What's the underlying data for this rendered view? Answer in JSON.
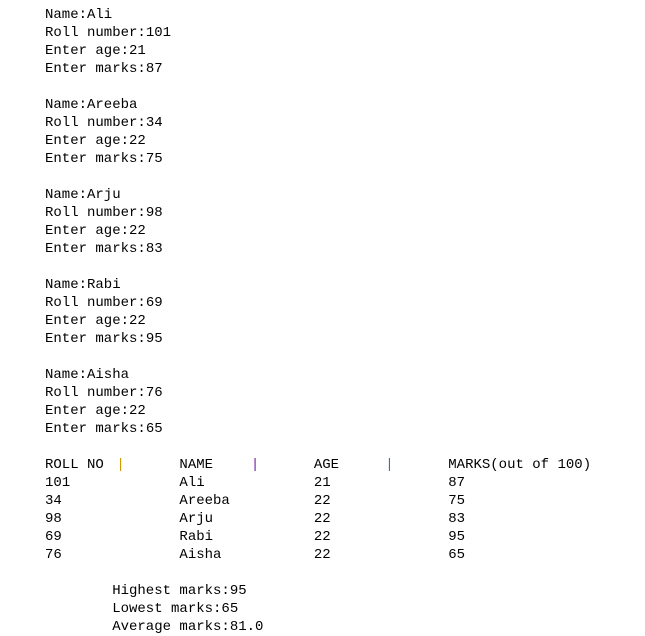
{
  "students": [
    {
      "name_line": "Name:Ali",
      "roll_line": "Roll number:101",
      "age_line": "Enter age:21",
      "marks_line": "Enter marks:87"
    },
    {
      "name_line": "Name:Areeba",
      "roll_line": "Roll number:34",
      "age_line": "Enter age:22",
      "marks_line": "Enter marks:75"
    },
    {
      "name_line": "Name:Arju",
      "roll_line": "Roll number:98",
      "age_line": "Enter age:22",
      "marks_line": "Enter marks:83"
    },
    {
      "name_line": "Name:Rabi",
      "roll_line": "Roll number:69",
      "age_line": "Enter age:22",
      "marks_line": "Enter marks:95"
    },
    {
      "name_line": "Name:Aisha",
      "roll_line": "Roll number:76",
      "age_line": "Enter age:22",
      "marks_line": "Enter marks:65"
    }
  ],
  "table": {
    "headers": [
      "ROLL NO",
      "NAME",
      "AGE",
      "MARKS(out of 100)"
    ],
    "separator": "|",
    "separator_colors": [
      "#d19a00",
      "#7a1fa2",
      "#3a6fb0"
    ],
    "rows": [
      [
        "101",
        "Ali",
        "21",
        "87"
      ],
      [
        "34",
        "Areeba",
        "22",
        "75"
      ],
      [
        "98",
        "Arju",
        "22",
        "83"
      ],
      [
        "69",
        "Rabi",
        "22",
        "95"
      ],
      [
        "76",
        "Aisha",
        "22",
        "65"
      ]
    ]
  },
  "summary": {
    "highest": "Highest marks:95",
    "lowest": "Lowest marks:65",
    "average": "Average marks:81.0"
  }
}
